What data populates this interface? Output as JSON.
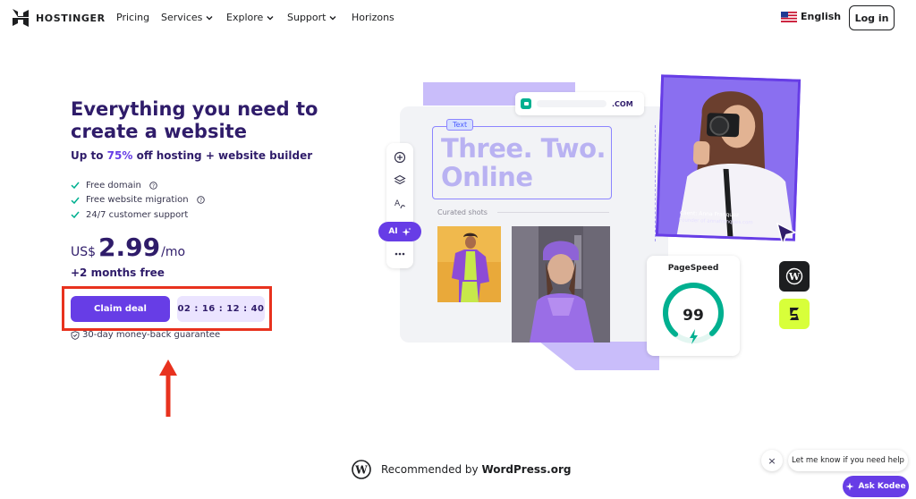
{
  "nav": {
    "brand": "HOSTINGER",
    "links": [
      {
        "label": "Pricing",
        "has_dropdown": false
      },
      {
        "label": "Services",
        "has_dropdown": true
      },
      {
        "label": "Explore",
        "has_dropdown": true
      },
      {
        "label": "Support",
        "has_dropdown": true
      },
      {
        "label": "Horizons",
        "has_dropdown": false
      }
    ],
    "language": "English",
    "login_label": "Log in"
  },
  "hero": {
    "title": "Everything you need to create a website",
    "subtitle_prefix": "Up to ",
    "subtitle_accent": "75%",
    "subtitle_suffix": " off hosting + website builder",
    "features": [
      "Free domain",
      "Free website migration",
      "24/7 customer support"
    ],
    "price_currency": "US$",
    "price_value": "2.99",
    "price_period": "/mo",
    "bonus": "+2 months free",
    "cta_label": "Claim deal",
    "countdown": "02 : 16 : 12 : 40",
    "guarantee": "30-day money-back guarantee"
  },
  "illustration": {
    "url_tld": ".COM",
    "text_chip": "Text",
    "headline_line1": "Three. Two.",
    "headline_line2": "Online",
    "curated_label": "Curated shots",
    "ai_label": "AI",
    "portrait_caption_name": "Client: Anna Franquez",
    "portrait_caption_role": "Founder of annafranques.com",
    "pagespeed_title": "PageSpeed",
    "pagespeed_score": "99",
    "pagespeed_fraction": 0.99
  },
  "footer": {
    "recommended_prefix": "Recommended by ",
    "recommended_brand": "WordPress.org"
  },
  "chat": {
    "bubble": "Let me know if you need help",
    "close": "×",
    "ask_label": "Ask Kodee"
  },
  "colors": {
    "primary": "#673de6",
    "dark_text": "#2f1c6a",
    "highlight_red": "#e8321e",
    "success_green": "#00b090",
    "light_purple": "#c9bdfa"
  }
}
